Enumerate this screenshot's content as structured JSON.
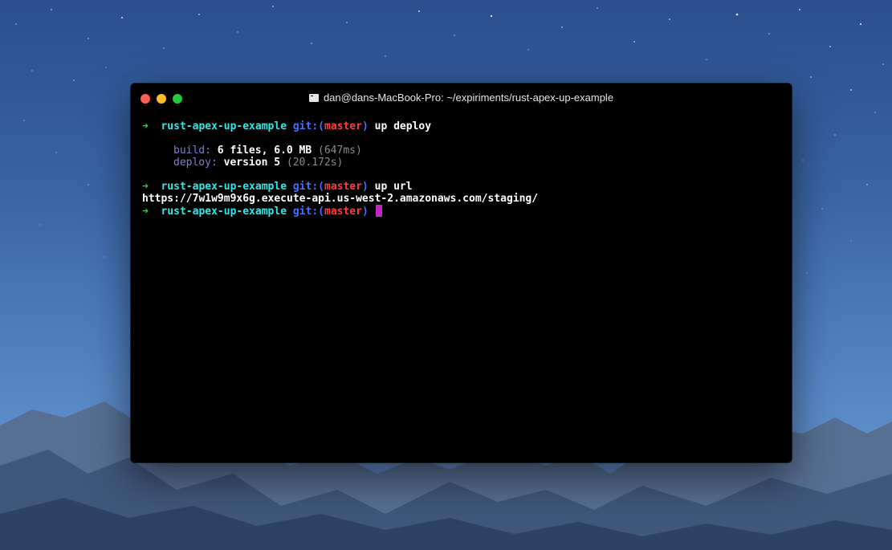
{
  "window": {
    "title": "dan@dans-MacBook-Pro: ~/expiriments/rust-apex-up-example"
  },
  "prompt": {
    "arrow": "➜",
    "dir": "rust-apex-up-example",
    "git_prefix": "git:(",
    "branch": "master",
    "git_suffix": ")"
  },
  "session": {
    "cmd1": "up deploy",
    "build_label": "build:",
    "build_value": "6 files, 6.0 MB",
    "build_time": "(647ms)",
    "deploy_label": "deploy:",
    "deploy_value": "version 5",
    "deploy_time": "(20.172s)",
    "cmd2": "up url",
    "url_output": "https://7w1w9m9x6g.execute-api.us-west-2.amazonaws.com/staging/"
  },
  "colors": {
    "arrow": "#31d046",
    "dir": "#33e6e6",
    "git": "#3f73ff",
    "branch": "#ff3b3b",
    "cursor": "#c227c2"
  },
  "icons": {
    "title_icon": "terminal-icon"
  }
}
